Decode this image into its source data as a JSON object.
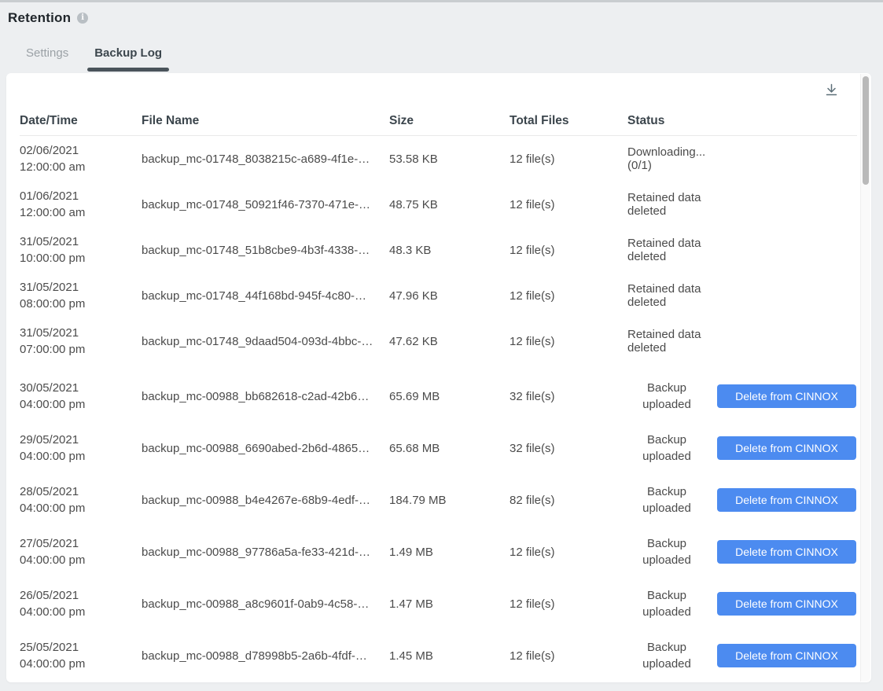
{
  "page": {
    "title": "Retention"
  },
  "tabs": [
    {
      "label": "Settings",
      "active": false
    },
    {
      "label": "Backup Log",
      "active": true
    }
  ],
  "table": {
    "columns": [
      "Date/Time",
      "File Name",
      "Size",
      "Total Files",
      "Status"
    ],
    "rows": [
      {
        "date": "02/06/2021",
        "time": "12:00:00 am",
        "file": "backup_mc-01748_8038215c-a689-4f1e-…",
        "size": "53.58 KB",
        "total": "12 file(s)",
        "status": "Downloading... (0/1)",
        "action": null
      },
      {
        "date": "01/06/2021",
        "time": "12:00:00 am",
        "file": "backup_mc-01748_50921f46-7370-471e-…",
        "size": "48.75 KB",
        "total": "12 file(s)",
        "status": "Retained data deleted",
        "action": null
      },
      {
        "date": "31/05/2021",
        "time": "10:00:00 pm",
        "file": "backup_mc-01748_51b8cbe9-4b3f-4338-…",
        "size": "48.3 KB",
        "total": "12 file(s)",
        "status": "Retained data deleted",
        "action": null
      },
      {
        "date": "31/05/2021",
        "time": "08:00:00 pm",
        "file": "backup_mc-01748_44f168bd-945f-4c80-…",
        "size": "47.96 KB",
        "total": "12 file(s)",
        "status": "Retained data deleted",
        "action": null
      },
      {
        "date": "31/05/2021",
        "time": "07:00:00 pm",
        "file": "backup_mc-01748_9daad504-093d-4bbc-…",
        "size": "47.62 KB",
        "total": "12 file(s)",
        "status": "Retained data deleted",
        "action": null
      },
      {
        "date": "30/05/2021",
        "time": "04:00:00 pm",
        "file": "backup_mc-00988_bb682618-c2ad-42b6…",
        "size": "65.69 MB",
        "total": "32 file(s)",
        "status": "Backup uploaded",
        "action": "Delete from CINNOX"
      },
      {
        "date": "29/05/2021",
        "time": "04:00:00 pm",
        "file": "backup_mc-00988_6690abed-2b6d-4865…",
        "size": "65.68 MB",
        "total": "32 file(s)",
        "status": "Backup uploaded",
        "action": "Delete from CINNOX"
      },
      {
        "date": "28/05/2021",
        "time": "04:00:00 pm",
        "file": "backup_mc-00988_b4e4267e-68b9-4edf-…",
        "size": "184.79 MB",
        "total": "82 file(s)",
        "status": "Backup uploaded",
        "action": "Delete from CINNOX"
      },
      {
        "date": "27/05/2021",
        "time": "04:00:00 pm",
        "file": "backup_mc-00988_97786a5a-fe33-421d-…",
        "size": "1.49 MB",
        "total": "12 file(s)",
        "status": "Backup uploaded",
        "action": "Delete from CINNOX"
      },
      {
        "date": "26/05/2021",
        "time": "04:00:00 pm",
        "file": "backup_mc-00988_a8c9601f-0ab9-4c58-…",
        "size": "1.47 MB",
        "total": "12 file(s)",
        "status": "Backup uploaded",
        "action": "Delete from CINNOX"
      },
      {
        "date": "25/05/2021",
        "time": "04:00:00 pm",
        "file": "backup_mc-00988_d78998b5-2a6b-4fdf-…",
        "size": "1.45 MB",
        "total": "12 file(s)",
        "status": "Backup uploaded",
        "action": "Delete from CINNOX"
      }
    ]
  },
  "icons": {
    "title_info": "info-icon",
    "toolbar_download": "download-icon"
  },
  "colors": {
    "accent_button": "#4c8bf0",
    "active_tab_underline": "#4a545b",
    "page_background": "#edeff1",
    "card_background": "#ffffff"
  }
}
